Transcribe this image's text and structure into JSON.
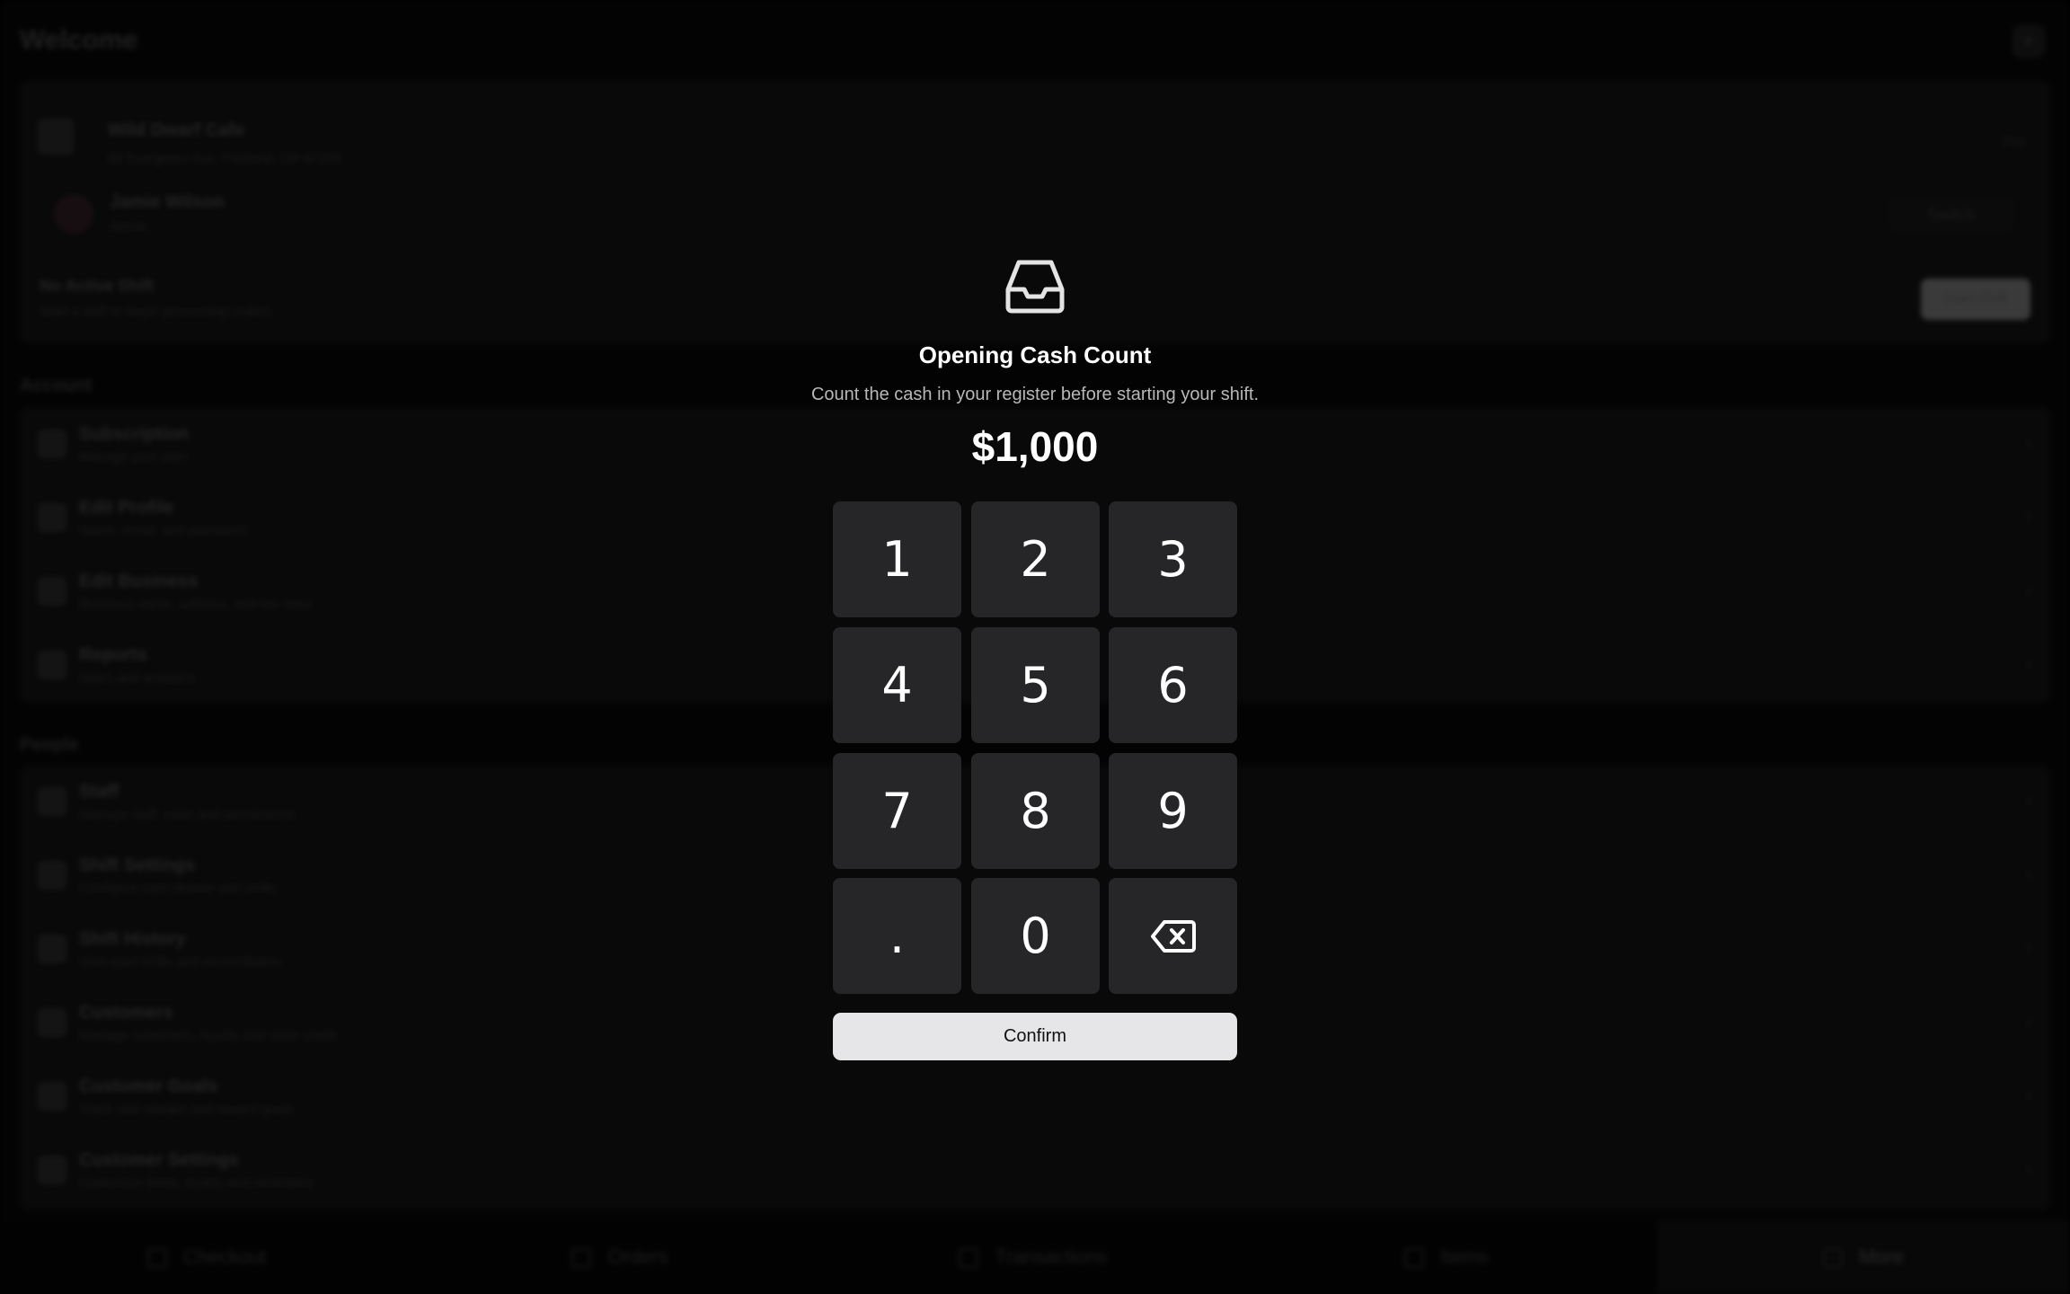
{
  "app": {
    "title": "Welcome",
    "close_icon": "x-icon",
    "business": {
      "name": "Wild Dwarf Cafe",
      "address": "88 Evergreen Ave, Portland, OR 97205",
      "action": "Pro"
    },
    "user": {
      "name": "Jamie Wilson",
      "role": "Admin",
      "action": "Switch"
    },
    "shift": {
      "title": "No Active Shift",
      "subtitle": "Start a shift to begin processing orders.",
      "action": "Start Shift"
    },
    "account_label": "Account",
    "account_items": [
      {
        "title": "Subscription",
        "subtitle": "Manage your plan",
        "icon": "card-icon"
      },
      {
        "title": "Edit Profile",
        "subtitle": "Name, email, and password",
        "icon": "user-icon"
      },
      {
        "title": "Edit Business",
        "subtitle": "Business name, address, and tax rates",
        "icon": "store-icon"
      },
      {
        "title": "Reports",
        "subtitle": "Sales and analytics",
        "icon": "chart-icon"
      }
    ],
    "people_label": "People",
    "people_items": [
      {
        "title": "Staff",
        "subtitle": "Manage staff, roles and permissions",
        "icon": "users-icon"
      },
      {
        "title": "Shift Settings",
        "subtitle": "Configure cash drawer and shifts",
        "icon": "clock-icon"
      },
      {
        "title": "Shift History",
        "subtitle": "View past shifts and reconciliation",
        "icon": "history-icon"
      },
      {
        "title": "Customers",
        "subtitle": "Manage customers, loyalty and store credit",
        "icon": "customers-icon"
      },
      {
        "title": "Customer Goals",
        "subtitle": "Track visit streaks and reward goals",
        "icon": "goal-icon"
      },
      {
        "title": "Customer Settings",
        "subtitle": "Customize fields, loyalty and reminders",
        "icon": "settings-icon"
      }
    ],
    "nav": [
      {
        "label": "Checkout",
        "icon": "cart-icon",
        "active": false
      },
      {
        "label": "Orders",
        "icon": "orders-icon",
        "active": false
      },
      {
        "label": "Transactions",
        "icon": "receipt-icon",
        "active": false
      },
      {
        "label": "Items",
        "icon": "box-icon",
        "active": false
      },
      {
        "label": "More",
        "icon": "menu-icon",
        "active": true
      }
    ]
  },
  "modal": {
    "icon": "inbox-icon",
    "title": "Opening Cash Count",
    "subtitle": "Count the cash in your register before starting your shift.",
    "amount": "$1,000",
    "keys": [
      "1",
      "2",
      "3",
      "4",
      "5",
      "6",
      "7",
      "8",
      "9",
      ".",
      "0"
    ],
    "backspace_icon": "backspace-icon",
    "confirm_label": "Confirm"
  }
}
